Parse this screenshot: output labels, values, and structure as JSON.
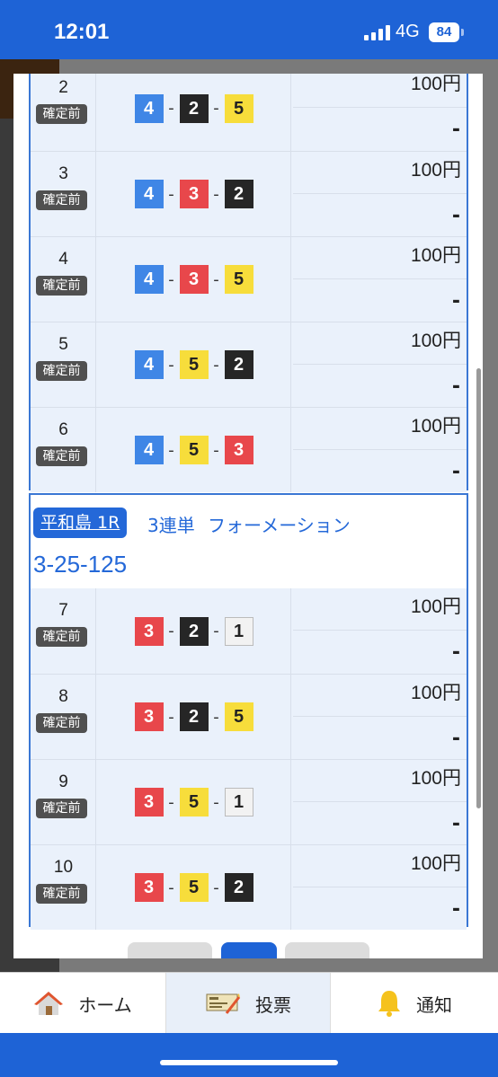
{
  "status_bar": {
    "time": "12:01",
    "network": "4G",
    "battery": "84"
  },
  "block1": {
    "rows": [
      {
        "num": "2",
        "status": "確定前",
        "boats": [
          "4",
          "2",
          "5"
        ],
        "colors": [
          "b4",
          "b2",
          "b5"
        ],
        "amount": "100円",
        "payout": "-"
      },
      {
        "num": "3",
        "status": "確定前",
        "boats": [
          "4",
          "3",
          "2"
        ],
        "colors": [
          "b4",
          "b3",
          "b2"
        ],
        "amount": "100円",
        "payout": "-"
      },
      {
        "num": "4",
        "status": "確定前",
        "boats": [
          "4",
          "3",
          "5"
        ],
        "colors": [
          "b4",
          "b3",
          "b5"
        ],
        "amount": "100円",
        "payout": "-"
      },
      {
        "num": "5",
        "status": "確定前",
        "boats": [
          "4",
          "5",
          "2"
        ],
        "colors": [
          "b4",
          "b5",
          "b2"
        ],
        "amount": "100円",
        "payout": "-"
      },
      {
        "num": "6",
        "status": "確定前",
        "boats": [
          "4",
          "5",
          "3"
        ],
        "colors": [
          "b4",
          "b5",
          "b3"
        ],
        "amount": "100円",
        "payout": "-"
      }
    ]
  },
  "block2": {
    "venue": "平和島 1R",
    "bet_type": "3連単",
    "bet_name": "フォーメーション",
    "combo_code": "3-25-125",
    "rows": [
      {
        "num": "7",
        "status": "確定前",
        "boats": [
          "3",
          "2",
          "1"
        ],
        "colors": [
          "b3",
          "b2",
          "b1"
        ],
        "amount": "100円",
        "payout": "-"
      },
      {
        "num": "8",
        "status": "確定前",
        "boats": [
          "3",
          "2",
          "5"
        ],
        "colors": [
          "b3",
          "b2",
          "b5"
        ],
        "amount": "100円",
        "payout": "-"
      },
      {
        "num": "9",
        "status": "確定前",
        "boats": [
          "3",
          "5",
          "1"
        ],
        "colors": [
          "b3",
          "b5",
          "b1"
        ],
        "amount": "100円",
        "payout": "-"
      },
      {
        "num": "10",
        "status": "確定前",
        "boats": [
          "3",
          "5",
          "2"
        ],
        "colors": [
          "b3",
          "b5",
          "b2"
        ],
        "amount": "100円",
        "payout": "-"
      }
    ]
  },
  "pager": {
    "active_index": 1,
    "count": 3,
    "active_color": "#1e63d6",
    "inactive_color": "#dcdcdc"
  },
  "tabs": [
    {
      "label": "ホーム",
      "icon": "house-icon",
      "active": false
    },
    {
      "label": "投票",
      "icon": "ticket-icon",
      "active": true
    },
    {
      "label": "通知",
      "icon": "bell-icon",
      "active": false
    }
  ]
}
